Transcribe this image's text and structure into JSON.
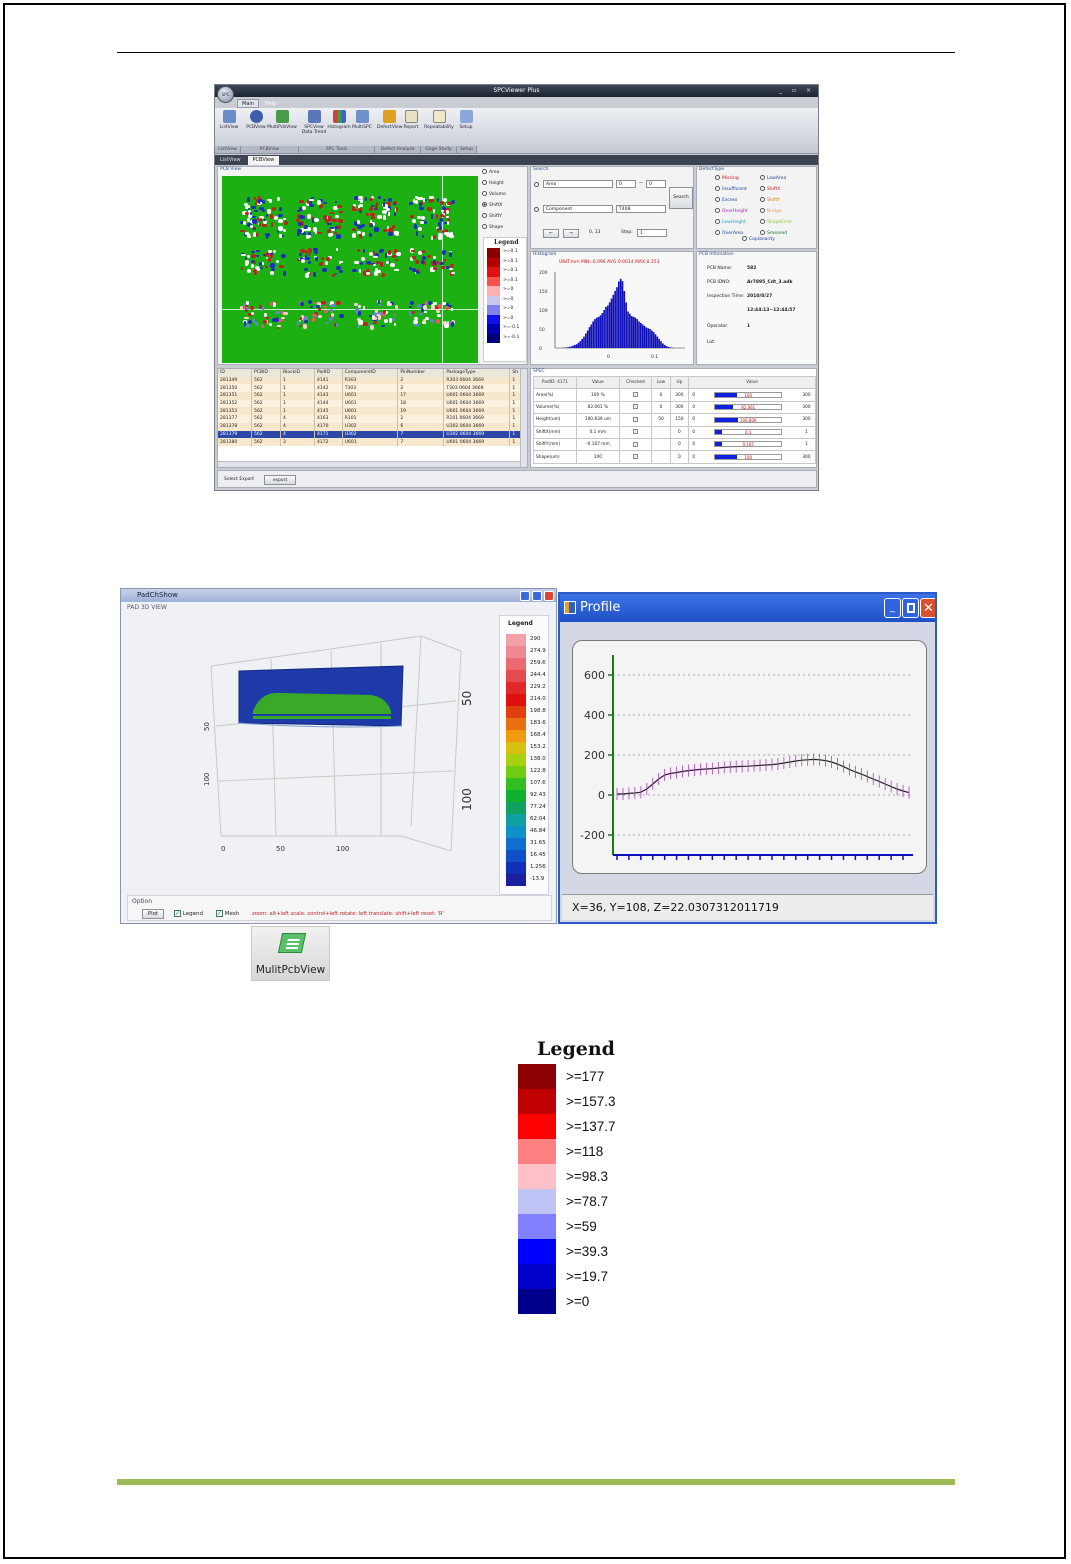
{
  "spc": {
    "title": "SPCViewer Plus",
    "orb_label": "SPC",
    "window_buttons": "_ ▫ ×",
    "ribbon_tabs": [
      "Main",
      "Help"
    ],
    "ribbon_buttons": [
      "ListView",
      "PCBView",
      "MultiPcbView",
      "SPCView Data Trend",
      "Histogram",
      "MultiSPC",
      "DefectView",
      "Report",
      "Repeatability",
      "Setup"
    ],
    "ribbon_groups": [
      "ListView",
      "PCBView",
      "SPC Tools",
      "Defect Analyze",
      "Gage Study",
      "Setup"
    ],
    "doc_tabs": [
      "ListView",
      "PCBView"
    ],
    "pcb_view": {
      "title": "PCB View",
      "metric_options": [
        "Area",
        "Height",
        "Volume",
        "ShiftX",
        "ShiftY",
        "Shape"
      ],
      "selected_metric": "ShiftX",
      "legend_title": "Legend",
      "legend_labels": [
        ">=0.1",
        ">=0.1",
        ">=0.1",
        ">=0.1",
        ">=0",
        ">=0",
        ">=0",
        ">=0",
        ">=-0.1",
        ">=-0.1"
      ],
      "legend_colors": [
        "#8a0000",
        "#b30000",
        "#e01010",
        "#ff5050",
        "#ffb0b0",
        "#c8c8ee",
        "#8080ee",
        "#1010ee",
        "#0000b0",
        "#00007a"
      ]
    },
    "search": {
      "title": "Search",
      "field1": "Area",
      "min": "0",
      "tilde": "~",
      "max": "0",
      "field2": "Component",
      "field2_value": "T408",
      "search_btn": "Search",
      "prev_btn": "←",
      "next_btn": "→",
      "page": "0, 13",
      "step_label": "Step:",
      "step_value": "1"
    },
    "defect_type": {
      "title": "DefectType",
      "left": [
        {
          "label": "Missing",
          "color": "#d01010"
        },
        {
          "label": "Insufficient",
          "color": "#1a3c9a"
        },
        {
          "label": "Excess",
          "color": "#1a3c9a"
        },
        {
          "label": "OverHeight",
          "color": "#b020b0"
        },
        {
          "label": "LowHeight",
          "color": "#20a0c0"
        },
        {
          "label": "OverArea",
          "color": "#1a3c9a"
        }
      ],
      "right": [
        {
          "label": "LowArea",
          "color": "#1a3c9a"
        },
        {
          "label": "ShiftX",
          "color": "#c02020"
        },
        {
          "label": "ShiftY",
          "color": "#c08020"
        },
        {
          "label": "Bridge",
          "color": "#e0a060"
        },
        {
          "label": "ShapeError",
          "color": "#90c040"
        },
        {
          "label": "Smeared",
          "color": "#1a6c2a"
        }
      ],
      "extra": {
        "label": "Coplanarity",
        "color": "#1a3c9a"
      }
    },
    "histogram": {
      "title": "Histogram",
      "stats": "UNIT:mm  MIN:-0.096  AVG:0.0014  MAX:0.153",
      "y_ticks": [
        "200",
        "150",
        "100",
        "50",
        "0"
      ],
      "x_ticks": [
        "0",
        "0.1"
      ]
    },
    "pcb_info": {
      "title": "PCB Infomation",
      "rows": [
        {
          "label": "PCB Name:",
          "value": "582"
        },
        {
          "label": "PCB IDNO:",
          "value": "Ar7895_Cdt_3.adk"
        },
        {
          "label": "Inspection Time:",
          "value": "2010/8/27"
        },
        {
          "label": "",
          "value": "12:44:13~12:44:57"
        },
        {
          "label": "Operator:",
          "value": "1"
        },
        {
          "label": "Lot:",
          "value": ""
        }
      ]
    },
    "table": {
      "columns": [
        "ID",
        "PCBID",
        "BlockID",
        "PadID",
        "ComponentID",
        "PinNumber",
        "PackageType",
        "Sh"
      ],
      "rows": [
        [
          "281349",
          "562",
          "1",
          "4141",
          "R303",
          "2",
          "R303 0604 3669",
          "1"
        ],
        [
          "281350",
          "562",
          "1",
          "4142",
          "T303",
          "2",
          "T303 0604 3669",
          "1"
        ],
        [
          "281351",
          "562",
          "1",
          "4143",
          "U601",
          "17",
          "U601 0604 3669",
          "1"
        ],
        [
          "281352",
          "562",
          "1",
          "4144",
          "U601",
          "18",
          "U601 0604 3669",
          "1"
        ],
        [
          "281353",
          "562",
          "1",
          "4145",
          "U601",
          "19",
          "U601 0604 3669",
          "1"
        ],
        [
          "281377",
          "562",
          "4",
          "4163",
          "R101",
          "2",
          "R101 0604 3669",
          "1"
        ],
        [
          "281378",
          "562",
          "4",
          "4170",
          "U302",
          "6",
          "U302 0604 3669",
          "1"
        ],
        [
          "281379",
          "562",
          "4",
          "4171",
          "U302",
          "7",
          "U302 0604 3669",
          "1"
        ],
        [
          "281380",
          "562",
          "3",
          "4172",
          "U601",
          "7",
          "U601 0604 3669",
          "1"
        ]
      ],
      "selected_index": 7
    },
    "spec": {
      "title": "SPEC",
      "head": [
        "PadID: 4171",
        "Value",
        "Checked",
        "Low",
        "Up",
        "Value"
      ],
      "rows": [
        {
          "name": "Area(%)",
          "value": "100 %",
          "low": "0",
          "up": "300",
          "min": "0",
          "bar": "100",
          "max": "300",
          "fill": 0.33
        },
        {
          "name": "Volume(%)",
          "value": "82.061 %",
          "low": "0",
          "up": "300",
          "min": "0",
          "bar": "82.061",
          "max": "300",
          "fill": 0.27
        },
        {
          "name": "Height(um)",
          "value": "100.839 um",
          "low": "50",
          "up": "150",
          "min": "0",
          "bar": "100.839",
          "max": "300",
          "fill": 0.34
        },
        {
          "name": "ShiftX(mm)",
          "value": "0.1 mm",
          "low": "",
          "up": "0",
          "min": "0",
          "bar": "0.1",
          "max": "1",
          "fill": 0.1
        },
        {
          "name": "ShiftY(mm)",
          "value": "-0.107 mm",
          "low": "",
          "up": "0",
          "min": "0",
          "bar": "0.107",
          "max": "1",
          "fill": 0.11
        },
        {
          "name": "Shape(um)",
          "value": "100",
          "low": "",
          "up": "0",
          "min": "0",
          "bar": "100",
          "max": "300",
          "fill": 0.33
        }
      ]
    },
    "bottom": {
      "label": "Select Export",
      "button": "export"
    }
  },
  "w3d": {
    "title": "PadChShow",
    "subtitle": "PAD 3D VIEW",
    "legend_title": "Legend",
    "legend_values": [
      "290",
      "274.9",
      "259.6",
      "244.4",
      "229.2",
      "214.0",
      "198.8",
      "183.6",
      "168.4",
      "153.2",
      "138.0",
      "122.8",
      "107.6",
      "92.43",
      "77.24",
      "62.04",
      "46.84",
      "31.65",
      "16.45",
      "1.256",
      "-13.9"
    ],
    "legend_colors": [
      "#f4a0a8",
      "#ef8890",
      "#ea6a70",
      "#e54a50",
      "#e02828",
      "#e01010",
      "#e04010",
      "#e87010",
      "#f09a10",
      "#d8c010",
      "#a8d010",
      "#70cc10",
      "#30c020",
      "#10b030",
      "#10a060",
      "#10a0a0",
      "#1090c8",
      "#1070d0",
      "#1050c8",
      "#1030b8",
      "#1a20a0"
    ],
    "axis_labels": [
      "0",
      "50",
      "100",
      "50",
      "100",
      "50",
      "100"
    ],
    "option_label": "Option",
    "plot_btn": "Plot",
    "legend_chk": "Legend",
    "mesh_chk": "Mesh",
    "hint": "zoom: alt+left   scale: control+left   rotate: left   translate: shift+left   reset: 'R'"
  },
  "profile": {
    "title": "Profile",
    "status": "X=36, Y=108, Z=22.0307312011719",
    "chart_data": {
      "type": "line",
      "y_ticks": [
        600,
        400,
        200,
        0,
        -200
      ],
      "ylim": [
        -300,
        700
      ],
      "x": [
        0,
        1,
        2,
        3,
        4,
        5,
        6,
        7,
        8,
        9,
        10,
        11,
        12,
        13,
        14,
        15,
        16,
        17,
        18,
        19,
        20,
        21,
        22,
        23,
        24,
        25,
        26,
        27,
        28,
        29,
        30,
        31,
        32,
        33,
        34,
        35,
        36,
        37,
        38,
        39,
        40,
        41,
        42,
        43,
        44,
        45,
        46,
        47,
        48,
        49
      ],
      "y": [
        5,
        5,
        8,
        10,
        14,
        30,
        55,
        80,
        100,
        108,
        112,
        118,
        122,
        125,
        128,
        130,
        132,
        135,
        138,
        140,
        142,
        143,
        144,
        146,
        148,
        150,
        152,
        155,
        160,
        165,
        170,
        174,
        176,
        178,
        176,
        172,
        165,
        155,
        142,
        128,
        115,
        105,
        92,
        80,
        68,
        55,
        42,
        30,
        20,
        12
      ]
    }
  },
  "mulit_pcb": {
    "label": "MulitPcbView"
  },
  "big_legend": {
    "title": "Legend",
    "items": [
      {
        "label": ">=177",
        "color": "#8b0000"
      },
      {
        "label": ">=157.3",
        "color": "#c00000"
      },
      {
        "label": ">=137.7",
        "color": "#ff0000"
      },
      {
        "label": ">=118",
        "color": "#ff8080"
      },
      {
        "label": ">=98.3",
        "color": "#ffc0c8"
      },
      {
        "label": ">=78.7",
        "color": "#c0c4f4"
      },
      {
        "label": ">=59",
        "color": "#8080ff"
      },
      {
        "label": ">=39.3",
        "color": "#0000ff"
      },
      {
        "label": ">=19.7",
        "color": "#0000c8"
      },
      {
        "label": ">=0",
        "color": "#00008b"
      }
    ]
  }
}
